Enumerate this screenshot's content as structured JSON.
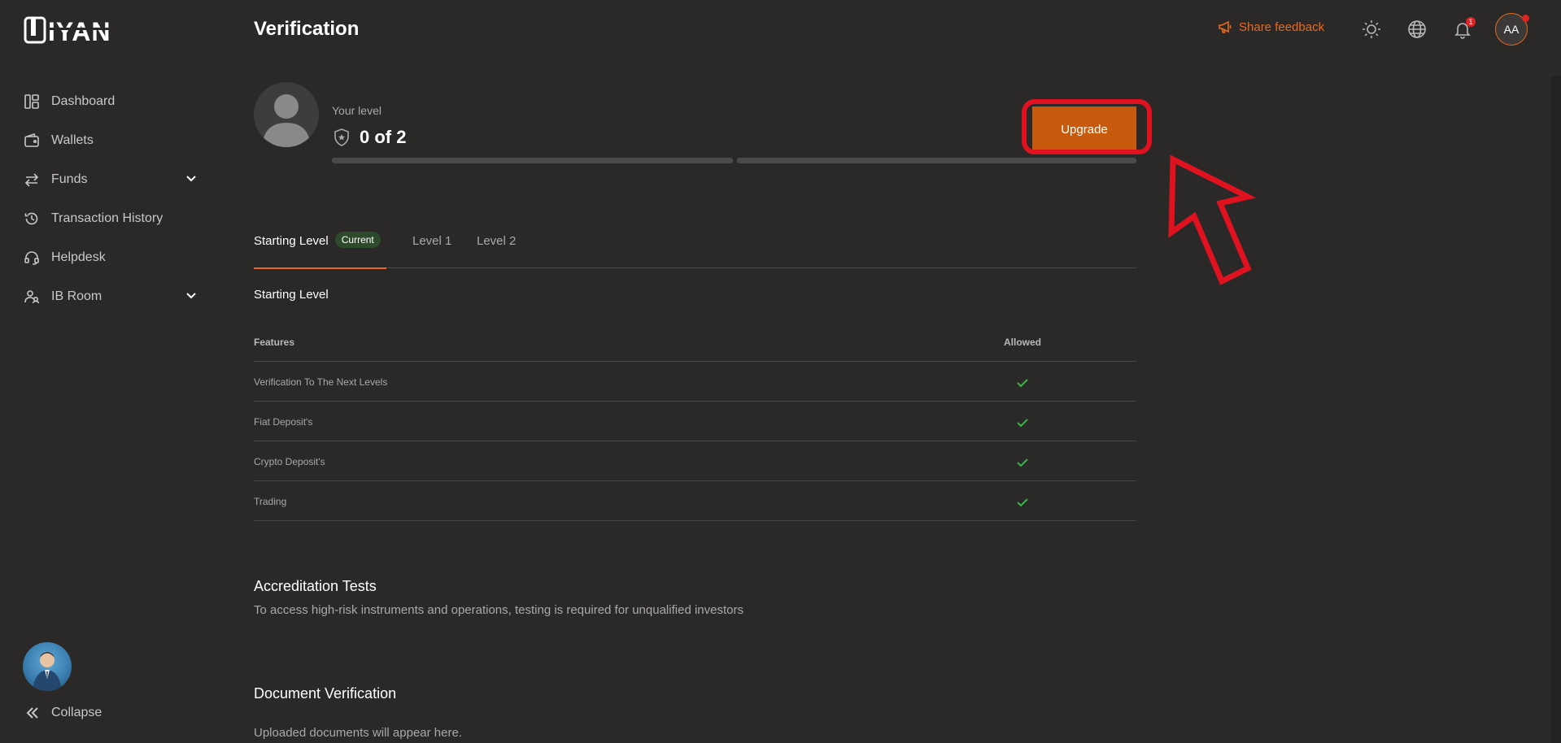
{
  "sidebar": {
    "items": [
      {
        "label": "Dashboard",
        "icon": "dashboard-icon"
      },
      {
        "label": "Wallets",
        "icon": "wallet-icon"
      },
      {
        "label": "Funds",
        "icon": "transfer-icon"
      },
      {
        "label": "Transaction History",
        "icon": "history-icon"
      },
      {
        "label": "Helpdesk",
        "icon": "headset-icon"
      },
      {
        "label": "IB Room",
        "icon": "people-icon"
      }
    ],
    "collapse_label": "Collapse"
  },
  "header": {
    "title": "Verification",
    "feedback_label": "Share feedback",
    "notification_count": "1",
    "user_initials": "AA"
  },
  "level": {
    "label": "Your level",
    "value": "0 of 2",
    "upgrade_label": "Upgrade"
  },
  "tabs": [
    {
      "label": "Starting Level",
      "badge": "Current",
      "active": true
    },
    {
      "label": "Level 1"
    },
    {
      "label": "Level 2"
    }
  ],
  "starting_level": {
    "title": "Starting Level",
    "columns": [
      "Features",
      "Allowed"
    ],
    "rows": [
      {
        "feature": "Verification To The Next Levels",
        "allowed": true
      },
      {
        "feature": "Fiat Deposit's",
        "allowed": true
      },
      {
        "feature": "Crypto Deposit's",
        "allowed": true
      },
      {
        "feature": "Trading",
        "allowed": true
      }
    ]
  },
  "accreditation": {
    "title": "Accreditation Tests",
    "description": "To access high-risk instruments and operations, testing is required for unqualified investors"
  },
  "documents": {
    "title": "Document Verification",
    "description": "Uploaded documents will appear here."
  },
  "colors": {
    "background": "#2a2928",
    "accent": "#e8691f",
    "upgrade_button": "#c75a0c",
    "highlight": "#e0121f",
    "check": "#3bb34a"
  }
}
